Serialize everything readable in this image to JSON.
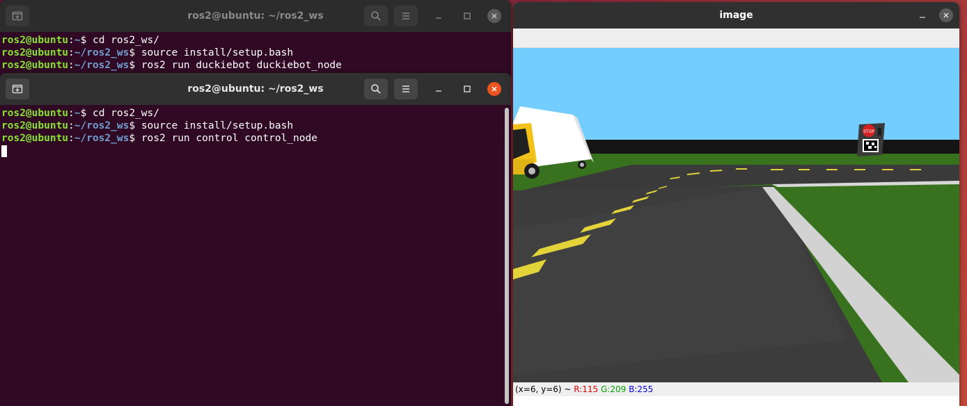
{
  "terminal_back": {
    "title": "ros2@ubuntu: ~/ros2_ws",
    "lines": [
      {
        "user": "ros2@ubuntu",
        "sep": ":",
        "path": "~",
        "prompt": "$ ",
        "cmd": "cd ros2_ws/"
      },
      {
        "user": "ros2@ubuntu",
        "sep": ":",
        "path": "~/ros2_ws",
        "prompt": "$ ",
        "cmd": "source install/setup.bash"
      },
      {
        "user": "ros2@ubuntu",
        "sep": ":",
        "path": "~/ros2_ws",
        "prompt": "$ ",
        "cmd": "ros2 run duckiebot duckiebot_node"
      }
    ]
  },
  "terminal_front": {
    "title": "ros2@ubuntu: ~/ros2_ws",
    "lines": [
      {
        "user": "ros2@ubuntu",
        "sep": ":",
        "path": "~",
        "prompt": "$ ",
        "cmd": "cd ros2_ws/"
      },
      {
        "user": "ros2@ubuntu",
        "sep": ":",
        "path": "~/ros2_ws",
        "prompt": "$ ",
        "cmd": "source install/setup.bash"
      },
      {
        "user": "ros2@ubuntu",
        "sep": ":",
        "path": "~/ros2_ws",
        "prompt": "$ ",
        "cmd": "ros2 run control control_node"
      }
    ]
  },
  "image_window": {
    "title": "image",
    "status": {
      "coords": "(x=6, y=6) ~ ",
      "r": "R:115",
      "g": "G:209",
      "b": "B:255"
    },
    "stop_sign_text": "STOP"
  },
  "icons": {
    "new_tab": "new-tab-icon",
    "search": "search-icon",
    "menu": "hamburger-menu-icon",
    "minimize": "minimize-icon",
    "maximize": "maximize-icon",
    "close": "close-icon"
  },
  "colors": {
    "terminal_bg": "#300a24",
    "prompt_user": "#8ae234",
    "prompt_path": "#729fcf",
    "close_active": "#e95420",
    "sky": "#73cdff"
  }
}
